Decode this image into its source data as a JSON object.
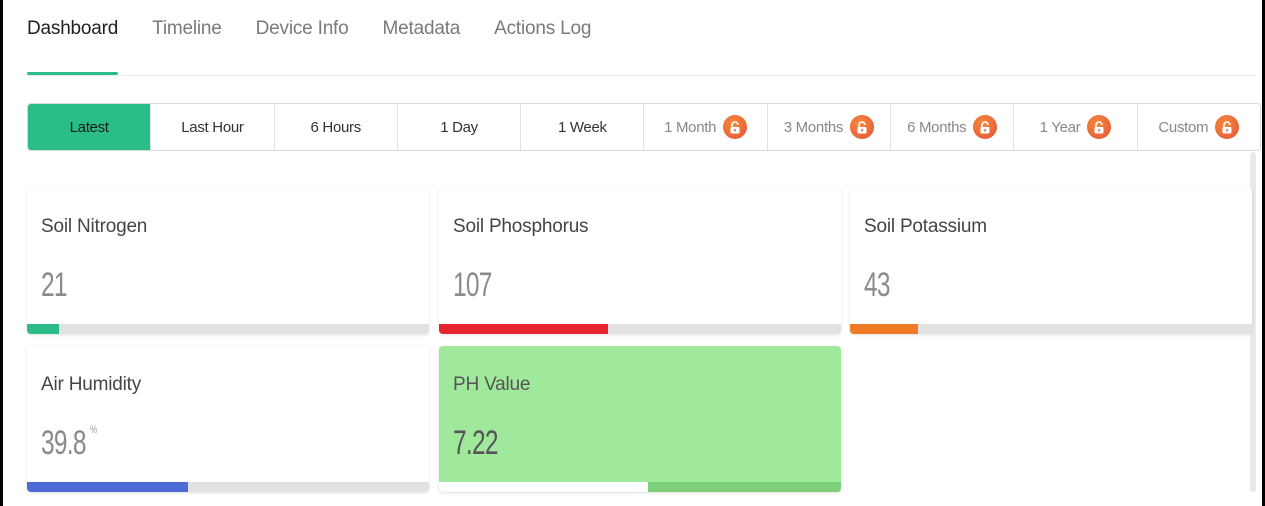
{
  "tabs": [
    "Dashboard",
    "Timeline",
    "Device Info",
    "Metadata",
    "Actions Log"
  ],
  "active_tab": "Dashboard",
  "ranges": {
    "latest": "Latest",
    "last_hour": "Last Hour",
    "six_hours": "6 Hours",
    "one_day": "1 Day",
    "one_week": "1 Week",
    "one_month": "1 Month",
    "three_months": "3 Months",
    "six_months": "6 Months",
    "one_year": "1 Year",
    "custom": "Custom"
  },
  "active_range": "Latest",
  "widgets": {
    "soil_nitrogen": {
      "title": "Soil Nitrogen",
      "value": "21",
      "level": 0.08,
      "color": "#2bbd87"
    },
    "soil_phosphorus": {
      "title": "Soil Phosphorus",
      "value": "107",
      "level": 0.42,
      "color": "#e6232f"
    },
    "soil_potassium": {
      "title": "Soil Potassium",
      "value": "43",
      "level": 0.17,
      "color": "#f07b26"
    },
    "air_humidity": {
      "title": "Air Humidity",
      "value": "39.8",
      "unit": "%",
      "level": 0.4,
      "color": "#4e6ad6"
    },
    "ph_value": {
      "title": "PH Value",
      "value": "7.22",
      "level": 0.52,
      "color": "#ffffff"
    }
  },
  "icons": {
    "lock": "unlock-icon"
  },
  "colors": {
    "accent": "#2bbd87",
    "lock_badge": "#e9622f"
  }
}
